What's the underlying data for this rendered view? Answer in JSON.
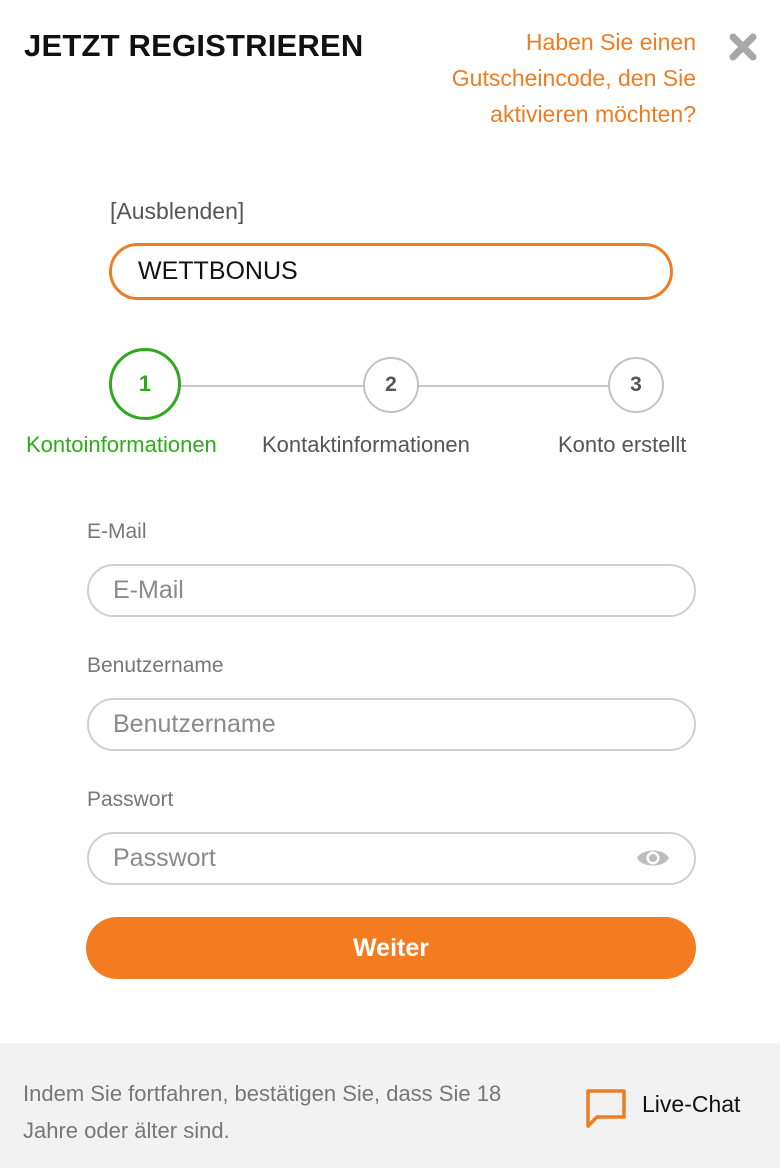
{
  "header": {
    "title": "JETZT REGISTRIEREN",
    "voucher_prompt": "Haben Sie einen Gutscheincode, den Sie aktivieren möchten?",
    "close_icon": "close-icon"
  },
  "voucher": {
    "hide_label": "[Ausblenden]",
    "code_value": "WETTBONUS"
  },
  "steps": [
    {
      "number": "1",
      "label": "Kontoinformationen",
      "active": true
    },
    {
      "number": "2",
      "label": "Kontaktinformationen",
      "active": false
    },
    {
      "number": "3",
      "label": "Konto erstellt",
      "active": false
    }
  ],
  "form": {
    "email_label": "E-Mail",
    "email_placeholder": "E-Mail",
    "username_label": "Benutzername",
    "username_placeholder": "Benutzername",
    "password_label": "Passwort",
    "password_placeholder": "Passwort",
    "submit_label": "Weiter"
  },
  "footer": {
    "notice": "Indem Sie fortfahren, bestätigen Sie, dass Sie 18 Jahre oder älter sind.",
    "chat_label": "Live-Chat"
  },
  "colors": {
    "accent": "#f07c22",
    "active_step": "#2eaa1b",
    "footer_bg": "#f2f2f2"
  }
}
